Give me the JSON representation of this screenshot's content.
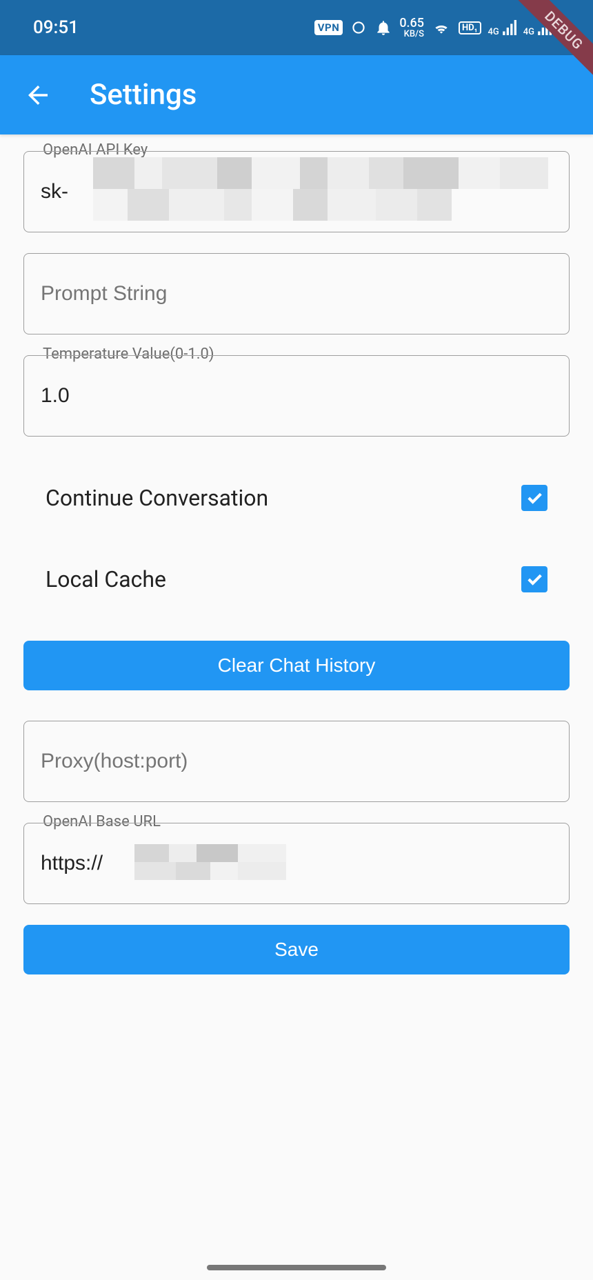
{
  "status_bar": {
    "time": "09:51",
    "vpn_label": "VPN",
    "speed_value": "0.65",
    "speed_unit": "KB/S",
    "hd_label": "HD",
    "net_label": "4G"
  },
  "debug_ribbon": "DEBUG",
  "app_bar": {
    "title": "Settings"
  },
  "fields": {
    "api_key": {
      "label": "OpenAI API Key",
      "value": "sk-"
    },
    "prompt": {
      "placeholder": "Prompt String",
      "value": ""
    },
    "temperature": {
      "label": "Temperature Value(0-1.0)",
      "value": "1.0"
    },
    "proxy": {
      "placeholder": "Proxy(host:port)",
      "value": ""
    },
    "base_url": {
      "label": "OpenAI Base URL",
      "value": "https://"
    }
  },
  "toggles": {
    "continue_conversation": {
      "label": "Continue Conversation",
      "checked": true
    },
    "local_cache": {
      "label": "Local Cache",
      "checked": true
    }
  },
  "buttons": {
    "clear_history": "Clear Chat History",
    "save": "Save"
  }
}
